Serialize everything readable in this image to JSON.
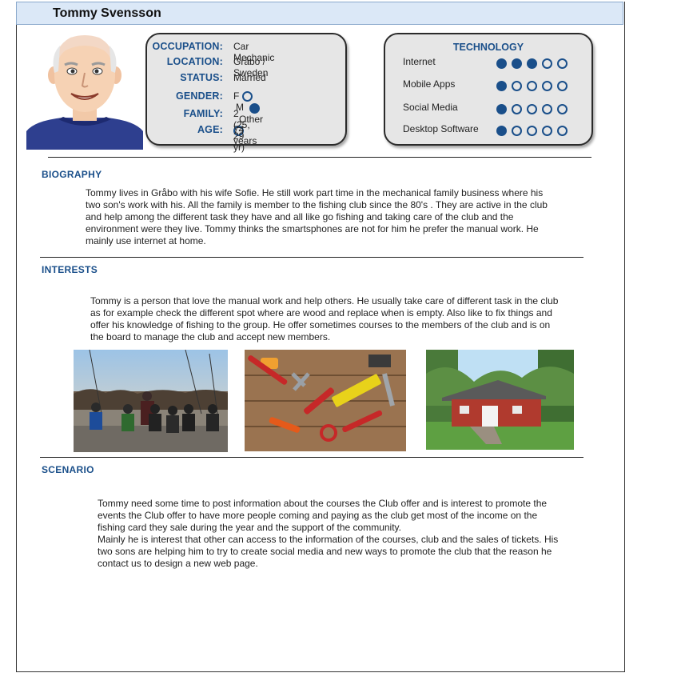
{
  "persona": {
    "name": "Tommy Svensson"
  },
  "info": {
    "occupation": {
      "label": "OCCUPATION:",
      "value": "Car Mechanic"
    },
    "location": {
      "label": "LOCATION:",
      "value": "Gråbo / Sweden"
    },
    "status": {
      "label": "STATUS:",
      "value": "Married"
    },
    "gender": {
      "label": "GENDER:",
      "options": [
        "F",
        "M",
        "Other"
      ],
      "selected": "M"
    },
    "family": {
      "label": "FAMILY:",
      "value": "2 (25, 29 yr)"
    },
    "age": {
      "label": "AGE:",
      "value": "74 years"
    }
  },
  "technology": {
    "title": "TECHNOLOGY",
    "max": 5,
    "items": [
      {
        "label": "Internet",
        "level": 3
      },
      {
        "label": "Mobile Apps",
        "level": 1
      },
      {
        "label": "Social Media",
        "level": 1
      },
      {
        "label": "Desktop Software",
        "level": 1
      }
    ]
  },
  "biography": {
    "heading": "BIOGRAPHY",
    "lines": [
      "Tommy lives in Gråbo with his wife Sofie.  He  still work part time in the mechanical family business  where his",
      "two son's work with his.  All the family is member to the fishing club since the 80's . They are active in the club",
      "and help among the different task they have and all like go fishing and taking care of the club and the",
      "environment were they live. Tommy thinks the smartsphones are not for him he prefer the manual work. He",
      "mainly use internet at home."
    ]
  },
  "interests": {
    "heading": "INTERESTS",
    "lines": [
      "Tommy is a person that love the manual work and help others. He usually take care of different task in the club",
      "as for example check the different spot where are wood and replace when is empty. Also like to fix things and",
      "offer his knowledge of fishing to the group. He offer sometimes courses to the members of the club and is on",
      "the board to manage the club and accept new members."
    ]
  },
  "scenario": {
    "heading": "SCENARIO",
    "lines": [
      "Tommy need some time to post information about the courses the Club offer and is interest to promote the",
      "events the Club offer to have more people coming and paying as the club get most of the income on the",
      "fishing card  they sale during the year and the support of the community.",
      "Mainly he is interest that other can access to the information of the courses, club and the sales of tickets. His",
      "two sons are helping him to try to create social media and new ways to promote the club that the reason he",
      "contact us to design a new web page."
    ]
  },
  "colors": {
    "accent": "#1a4f8a",
    "titlebar": "#dbe8f7",
    "box": "#e6e6e6"
  }
}
